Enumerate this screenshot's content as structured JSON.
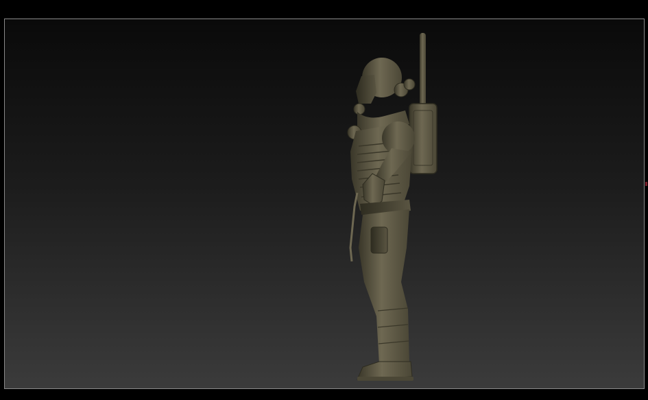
{
  "app": {
    "title": ""
  },
  "canvas": {
    "background_top": "#0a0a0a",
    "background_bottom": "#3b3b3b",
    "border_color": "#8a8a8a"
  },
  "model": {
    "subject": "figure-sculpt",
    "material_color": "#615c49",
    "material_highlight": "#8a8468",
    "material_shadow": "#3a3729"
  },
  "edge_marker": {
    "color": "#7a1f2a"
  }
}
